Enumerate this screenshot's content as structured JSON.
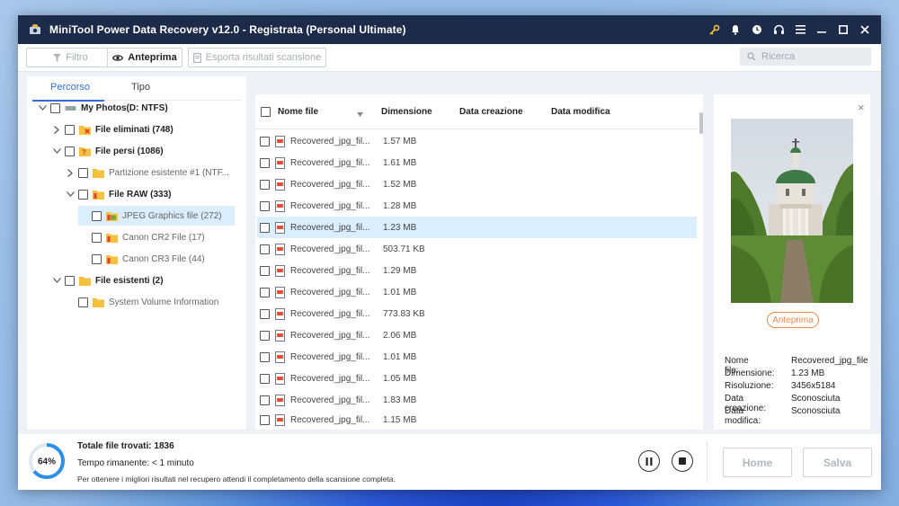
{
  "window": {
    "title": "MiniTool Power Data Recovery v12.0 - Registrata (Personal Ultimate)"
  },
  "toolbar": {
    "filter_label": "Filtro",
    "preview_label": "Anteprima",
    "export_label": "Esporta risultati scansione",
    "search_placeholder": "Ricerca"
  },
  "tree": {
    "tabs": [
      "Percorso",
      "Tipo"
    ],
    "active_tab": "Percorso",
    "items": [
      {
        "label": "My Photos(D: NTFS)"
      },
      {
        "label": "File eliminati (748)"
      },
      {
        "label": "File persi (1086)"
      },
      {
        "label": "Partizione esistente #1 (NTF..."
      },
      {
        "label": "File RAW (333)"
      },
      {
        "label": "JPEG Graphics file (272)"
      },
      {
        "label": "Canon CR2 File (17)"
      },
      {
        "label": "Canon CR3 File (44)"
      },
      {
        "label": "File esistenti (2)"
      },
      {
        "label": "System Volume Information"
      }
    ]
  },
  "list": {
    "columns": [
      "Nome file",
      "Dimensione",
      "Data creazione",
      "Data modifica"
    ],
    "rows": [
      {
        "name": "Recovered_jpg_fil...",
        "size": "1.57 MB"
      },
      {
        "name": "Recovered_jpg_fil...",
        "size": "1.61 MB"
      },
      {
        "name": "Recovered_jpg_fil...",
        "size": "1.52 MB"
      },
      {
        "name": "Recovered_jpg_fil...",
        "size": "1.28 MB"
      },
      {
        "name": "Recovered_jpg_fil...",
        "size": "1.23 MB"
      },
      {
        "name": "Recovered_jpg_fil...",
        "size": "503.71 KB"
      },
      {
        "name": "Recovered_jpg_fil...",
        "size": "1.29 MB"
      },
      {
        "name": "Recovered_jpg_fil...",
        "size": "1.01 MB"
      },
      {
        "name": "Recovered_jpg_fil...",
        "size": "773.83 KB"
      },
      {
        "name": "Recovered_jpg_fil...",
        "size": "2.06 MB"
      },
      {
        "name": "Recovered_jpg_fil...",
        "size": "1.01 MB"
      },
      {
        "name": "Recovered_jpg_fil...",
        "size": "1.05 MB"
      },
      {
        "name": "Recovered_jpg_fil...",
        "size": "1.83 MB"
      },
      {
        "name": "Recovered_jpg_fil...",
        "size": "1.15 MB"
      }
    ],
    "selected_row": 4
  },
  "preview": {
    "button_label": "Anteprima",
    "fields": [
      {
        "key": "Nome file:",
        "value": "Recovered_jpg_file"
      },
      {
        "key": "Dimensione:",
        "value": "1.23 MB"
      },
      {
        "key": "Risoluzione:",
        "value": "3456x5184"
      },
      {
        "key": "Data creazione:",
        "value": "Sconosciuta"
      },
      {
        "key": "Data modifica:",
        "value": "Sconosciuta"
      }
    ]
  },
  "status": {
    "progress_percent": 64,
    "progress_label": "64%",
    "total_label": "Totale file trovati:",
    "total_value": "1836",
    "remaining_label": "Tempo rimanente:",
    "remaining_value": "< 1 minuto",
    "note": "Per ottenere i migliori risultati nel recupero attendi il completamento della scansione completa.",
    "home_label": "Home",
    "save_label": "Salva"
  },
  "colors": {
    "accent": "#2f6fde",
    "titlebar": "#1d2b4b",
    "preview_button": "#f08a4b",
    "progress": "#2b8fe6"
  }
}
